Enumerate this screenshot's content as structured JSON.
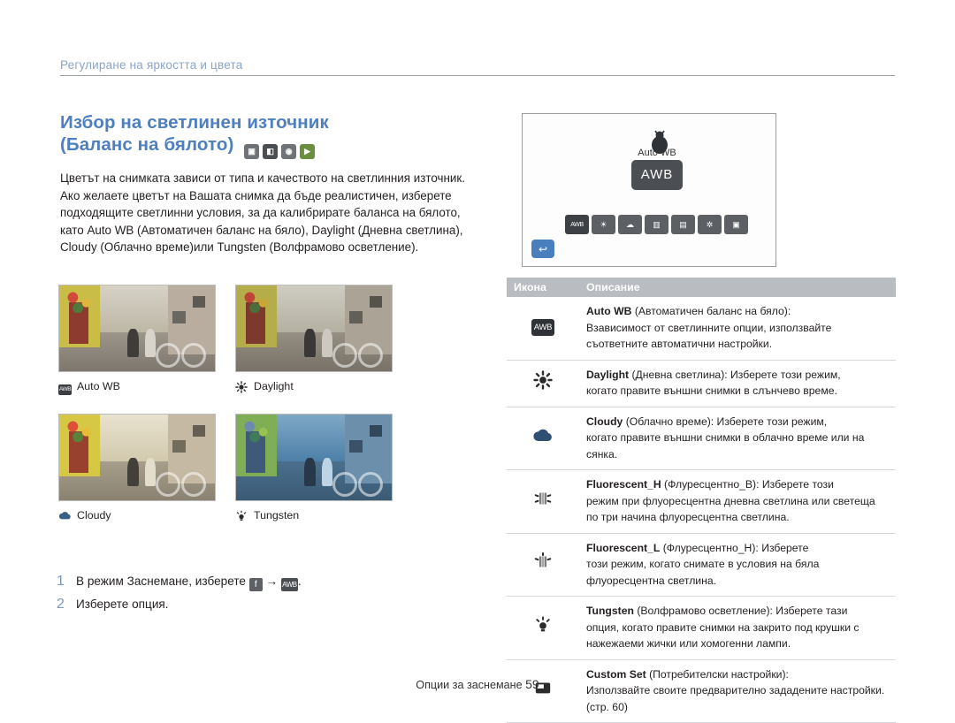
{
  "running_head": "Регулиране на яркостта и цвета",
  "section": {
    "title_line1": "Избор на светлинен източник",
    "title_line2": "(Баланс на бялото)",
    "title_icons": [
      "photo-mode-icon",
      "dual-is-icon",
      "smart-auto-icon",
      "movie-icon"
    ],
    "body": "Цветът на снимката зависи от типа и качеството на светлинния източник. Ако желаете цветът на Вашата снимка да бъде реалистичен, изберете подходящите светлинни условия, за да калибрирате баланса на бялото, като Auto WB (Автоматичен баланс на бяло), Daylight (Дневна светлина), Cloudy (Облачно време)или Tungsten (Волфрамово осветление)."
  },
  "samples": [
    {
      "caption": "Auto WB",
      "icon": "awb-icon"
    },
    {
      "caption": "Daylight",
      "icon": "sun-icon"
    },
    {
      "caption": "Cloudy",
      "icon": "cloud-icon"
    },
    {
      "caption": "Tungsten",
      "icon": "bulb-icon"
    }
  ],
  "steps": [
    {
      "num": "1",
      "text_before": "В режим Заснемане, изберете",
      "text_after": "."
    },
    {
      "num": "2",
      "text": "Изберете опция."
    }
  ],
  "camera_screen": {
    "awb_label": "Auto WB",
    "awb_value": "AWB",
    "strip_items": [
      "AWB",
      "Daylight",
      "Cloudy",
      "FluorescentH",
      "FluorescentL",
      "Tungsten",
      "CustomSet"
    ],
    "back_icon": "back-arrow-icon"
  },
  "table": {
    "headers": {
      "icon": "Икона",
      "description": "Описание"
    },
    "rows": [
      {
        "icon": "awb-icon",
        "name": "Auto WB",
        "name_rest": " (Автоматичен баланс на бяло):",
        "desc": "Взависимост от светлинните опции, използвайте съответните автоматични настройки."
      },
      {
        "icon": "sun-icon",
        "name": "Daylight",
        "name_rest": " (Дневна светлина): Изберете този режим,",
        "desc": "когато правите външни снимки в слънчево време."
      },
      {
        "icon": "cloud-icon",
        "name": "Cloudy",
        "name_rest": " (Облачно време): Изберете този режим,",
        "desc": "когато правите външни снимки в облачно време или на сянка."
      },
      {
        "icon": "fluorescent-h-icon",
        "name": "Fluorescent_H",
        "name_rest": " (Флуресцентно_В): Изберете този",
        "desc": "режим при флуоресцентна дневна светлина или светеща по три начина флуоресцентна светлина."
      },
      {
        "icon": "fluorescent-l-icon",
        "name": "Fluorescent_L",
        "name_rest": " (Флуресцентно_Н): Изберете",
        "desc": "този режим, когато снимате в условия на бяла флуоресцентна светлина."
      },
      {
        "icon": "bulb-icon",
        "name": "Tungsten",
        "name_rest": " (Волфрамово осветление): Изберете тази",
        "desc": "опция, когато правите снимки на закрито под крушки с нажежаеми жички или хомогенни лампи."
      },
      {
        "icon": "custom-set-icon",
        "name": "Custom Set",
        "name_rest": " (Потребителски настройки):",
        "desc": "Използвайте своите предварително зададените настройки. (стр. 60)"
      }
    ]
  },
  "footer": {
    "text": "Опции за заснемане",
    "page": "59"
  },
  "colors": {
    "accent": "#4d7fc1",
    "running_head": "#8aa4c8",
    "table_header_bg": "#b9bcc0",
    "step_num": "#7e97b8"
  }
}
